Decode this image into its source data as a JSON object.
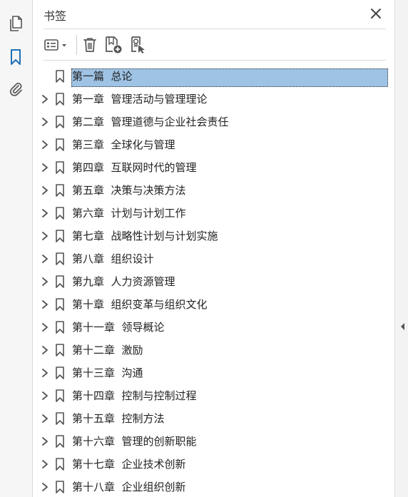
{
  "panel": {
    "title": "书签"
  },
  "rail": {
    "items": [
      {
        "icon": "pages-icon"
      },
      {
        "icon": "bookmark-icon",
        "active": true
      },
      {
        "icon": "paperclip-icon"
      }
    ]
  },
  "toolbar": {
    "tools": [
      "options-menu-icon",
      "delete-icon",
      "new-bookmark-icon",
      "bookmark-from-selection-icon"
    ]
  },
  "colors": {
    "accent": "#1f6fb5",
    "selection": "#9ec3e4",
    "icon": "#555555"
  },
  "bookmarks": [
    {
      "label": "第一篇  总论",
      "expandable": false,
      "selected": true
    },
    {
      "label": "第一章  管理活动与管理理论",
      "expandable": true
    },
    {
      "label": "第二章  管理道德与企业社会责任",
      "expandable": true
    },
    {
      "label": "第三章  全球化与管理",
      "expandable": true
    },
    {
      "label": "第四章  互联网时代的管理",
      "expandable": true
    },
    {
      "label": "第五章  决策与决策方法",
      "expandable": true
    },
    {
      "label": "第六章  计划与计划工作",
      "expandable": true
    },
    {
      "label": "第七章  战略性计划与计划实施",
      "expandable": true
    },
    {
      "label": "第八章  组织设计",
      "expandable": true
    },
    {
      "label": "第九章  人力资源管理",
      "expandable": true
    },
    {
      "label": "第十章  组织变革与组织文化",
      "expandable": true
    },
    {
      "label": "第十一章  领导概论",
      "expandable": true
    },
    {
      "label": "第十二章  激励",
      "expandable": true
    },
    {
      "label": "第十三章  沟通",
      "expandable": true
    },
    {
      "label": "第十四章  控制与控制过程",
      "expandable": true
    },
    {
      "label": "第十五章  控制方法",
      "expandable": true
    },
    {
      "label": "第十六章  管理的创新职能",
      "expandable": true
    },
    {
      "label": "第十七章  企业技术创新",
      "expandable": true
    },
    {
      "label": "第十八章  企业组织创新",
      "expandable": true
    }
  ]
}
